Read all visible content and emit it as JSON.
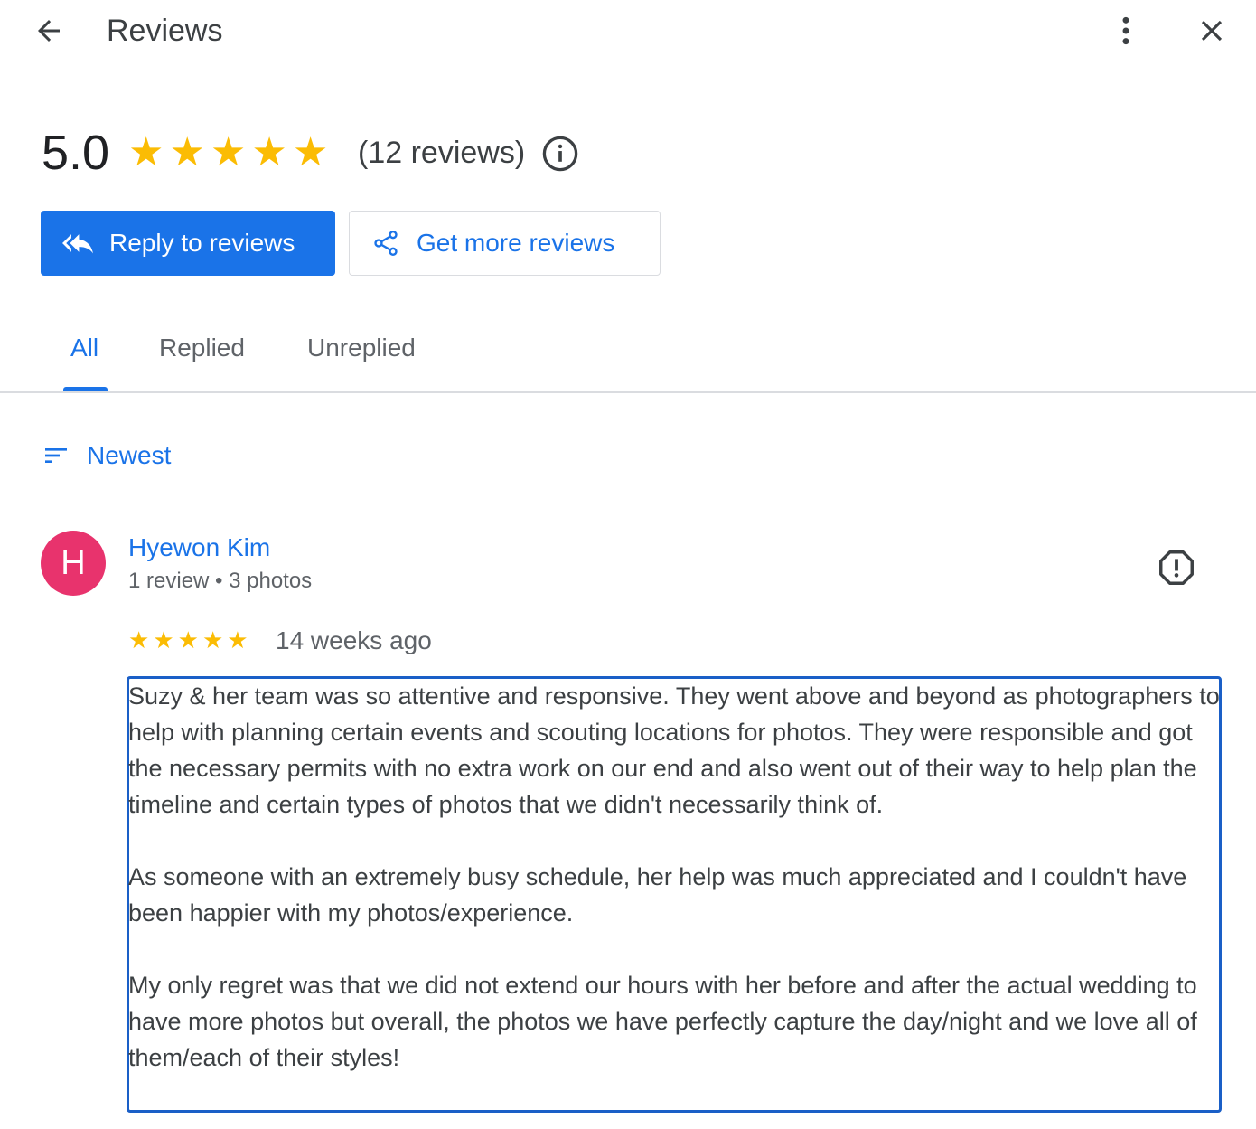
{
  "header": {
    "title": "Reviews",
    "back_icon": "arrow-left-icon",
    "more_icon": "more-vert-icon",
    "close_icon": "close-icon"
  },
  "summary": {
    "rating": "5.0",
    "stars": 5,
    "review_count": "(12 reviews)",
    "info_icon": "info-icon"
  },
  "actions": {
    "reply_label": "Reply to reviews",
    "reply_icon": "reply-all-icon",
    "get_more_label": "Get more reviews",
    "share_icon": "share-icon"
  },
  "tabs": [
    {
      "label": "All",
      "active": true
    },
    {
      "label": "Replied",
      "active": false
    },
    {
      "label": "Unreplied",
      "active": false
    }
  ],
  "sort": {
    "label": "Newest",
    "icon": "sort-icon"
  },
  "review": {
    "avatar_letter": "H",
    "avatar_color": "#e8336d",
    "name": "Hyewon Kim",
    "meta": "1 review • 3 photos",
    "stars": 5,
    "time": "14 weeks ago",
    "report_icon": "report-icon",
    "paragraphs": [
      "Suzy & her team was so attentive and responsive. They went above and beyond as photographers to help with planning certain events and scouting locations for photos. They were responsible and got the necessary permits with no extra work on our end and also went out of their way to help plan the timeline and certain types of photos that we didn't necessarily think of.",
      "As someone with an extremely busy schedule, her help was much appreciated and I couldn't have been happier with my photos/experience.",
      "My only regret was that we did not extend our hours with her before and after the actual wedding to have more photos but overall, the photos we have perfectly capture the day/night and we love all of them/each of their styles!"
    ]
  },
  "colors": {
    "accent": "#1a73e8",
    "star": "#fbbc04",
    "divider": "#dadce0"
  }
}
